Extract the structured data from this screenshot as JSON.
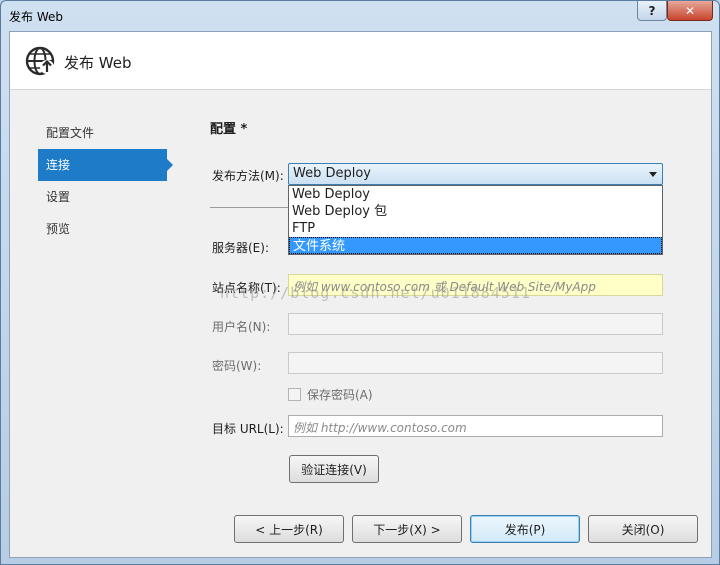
{
  "window": {
    "title": "发布 Web",
    "help_label": "?",
    "close_label": "✕"
  },
  "header": {
    "title": "发布 Web",
    "icon": "globe-publish-icon"
  },
  "nav": {
    "items": [
      {
        "label": "配置文件",
        "active": false
      },
      {
        "label": "连接",
        "active": true
      },
      {
        "label": "设置",
        "active": false
      },
      {
        "label": "预览",
        "active": false
      }
    ]
  },
  "main": {
    "section_title": "配置 *",
    "publish_method_label": "发布方法(M):",
    "publish_method_value": "Web Deploy",
    "publish_method_options": [
      "Web Deploy",
      "Web Deploy 包",
      "FTP",
      "文件系统"
    ],
    "highlighted_option": "文件系统",
    "server_label": "服务器(E):",
    "site_name_label": "站点名称(T):",
    "site_name_placeholder": "例如 www.contoso.com 或 Default Web Site/MyApp",
    "username_label": "用户名(N):",
    "password_label": "密码(W):",
    "save_password_label": "保存密码(A)",
    "target_url_label": "目标 URL(L):",
    "target_url_placeholder": "例如 http://www.contoso.com",
    "validate_button": "验证连接(V)",
    "watermark": "http://blog.csdn.net/u011884511"
  },
  "footer": {
    "prev_button": "< 上一步(R)",
    "next_button": "下一步(X) >",
    "publish_button": "发布(P)",
    "close_button": "关闭(O)"
  }
}
